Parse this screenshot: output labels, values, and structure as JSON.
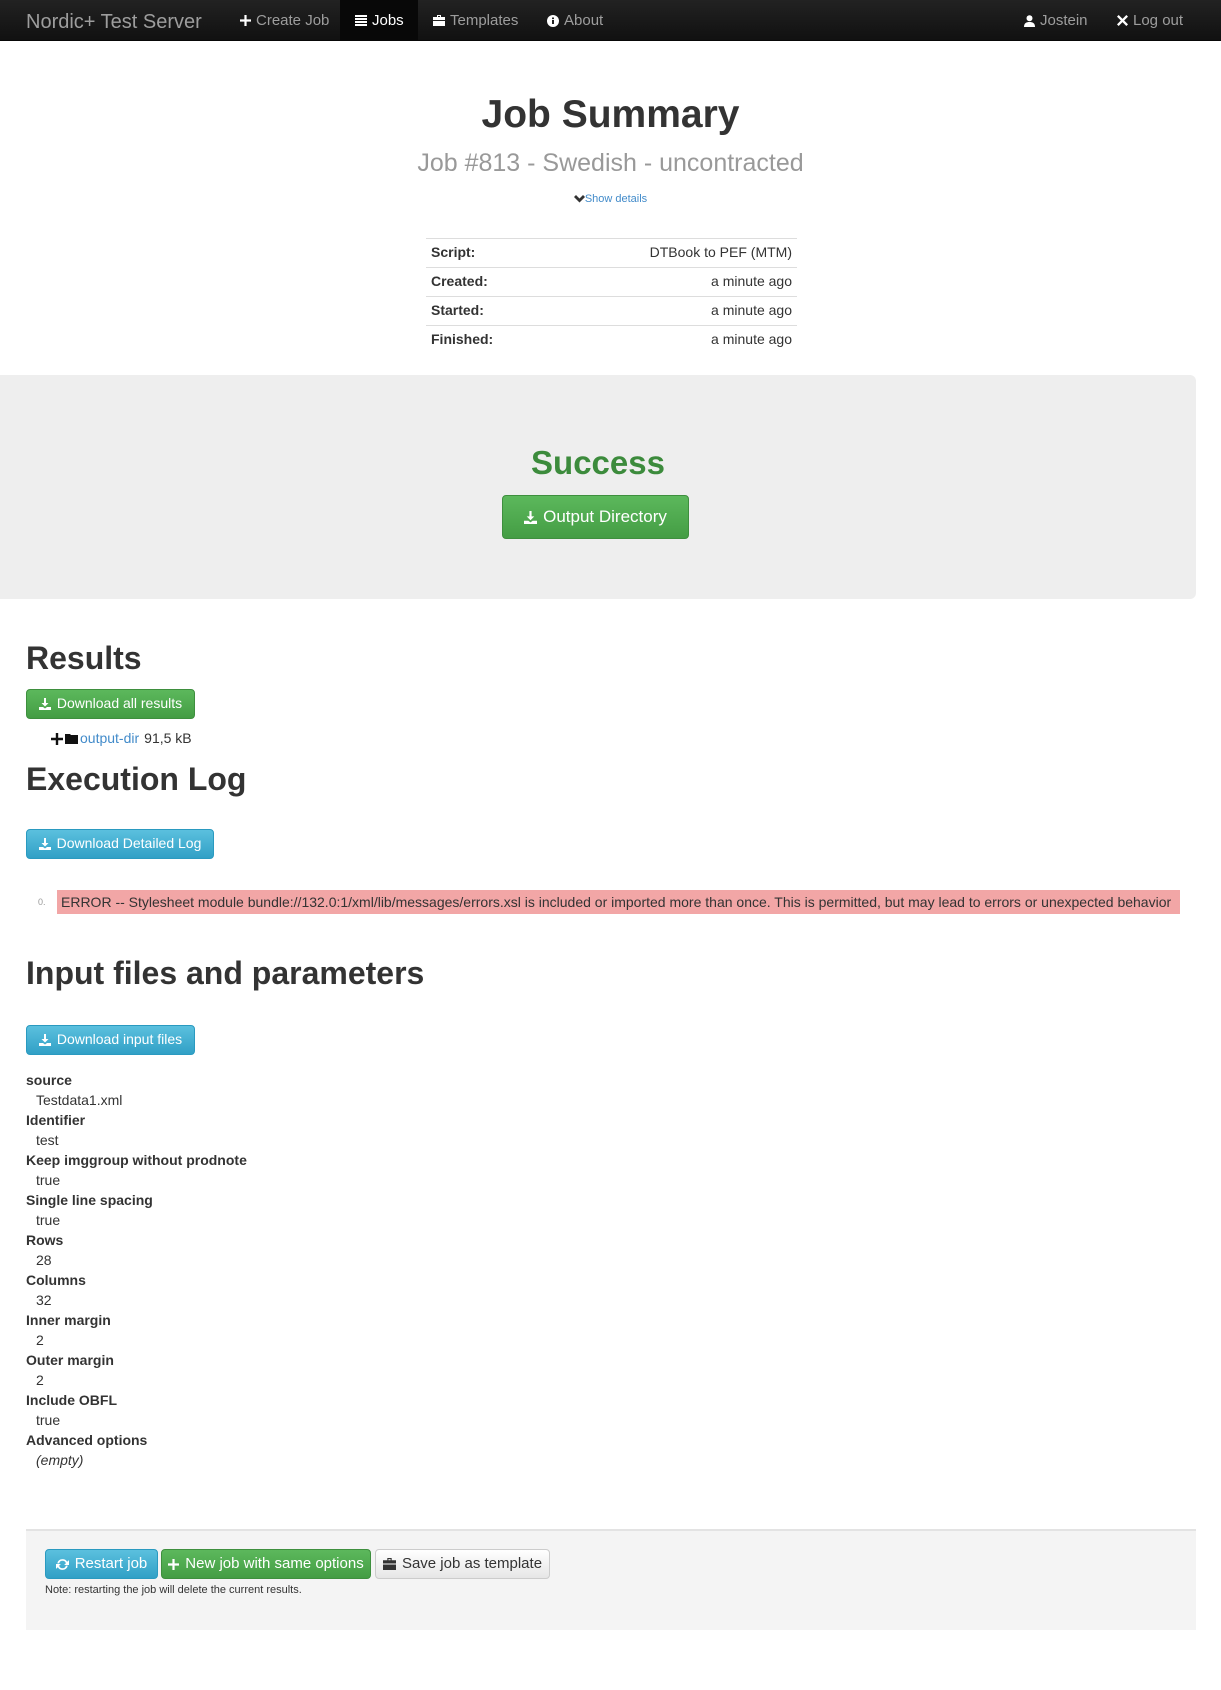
{
  "navbar": {
    "brand": "Nordic+ Test Server",
    "items": [
      {
        "label": "Create Job",
        "icon": "plus-icon",
        "active": false
      },
      {
        "label": "Jobs",
        "icon": "list-icon",
        "active": true
      },
      {
        "label": "Templates",
        "icon": "briefcase-icon",
        "active": false
      },
      {
        "label": "About",
        "icon": "info-icon",
        "active": false
      }
    ],
    "user": {
      "label": "Jostein",
      "icon": "user-icon"
    },
    "logout": {
      "label": "Log out",
      "icon": "close-icon"
    }
  },
  "header": {
    "title": "Job Summary",
    "subtitle": "Job #813 - Swedish - uncontracted",
    "show_details": "Show details"
  },
  "summary": [
    {
      "key": "Script:",
      "value": "DTBook to PEF (MTM)"
    },
    {
      "key": "Created:",
      "value": "a minute ago"
    },
    {
      "key": "Started:",
      "value": "a minute ago"
    },
    {
      "key": "Finished:",
      "value": "a minute ago"
    }
  ],
  "status": {
    "label": "Success",
    "color": "#3c8b3c",
    "output_button": "Output Directory"
  },
  "results": {
    "heading": "Results",
    "download_all": "Download all results",
    "items": [
      {
        "name": "output-dir",
        "size": "91,5 kB"
      }
    ]
  },
  "log": {
    "heading": "Execution Log",
    "download": "Download Detailed Log",
    "entries": [
      {
        "index": "0.",
        "level": "ERROR",
        "message": "ERROR -- Stylesheet module bundle://132.0:1/xml/lib/messages/errors.xsl is included or imported more than once. This is permitted, but may lead to errors or unexpected behavior",
        "color": "#f2a6a6"
      }
    ]
  },
  "inputs": {
    "heading": "Input files and parameters",
    "download": "Download input files",
    "params": [
      {
        "name": "source",
        "value": "Testdata1.xml"
      },
      {
        "name": "Identifier",
        "value": "test"
      },
      {
        "name": "Keep imggroup without prodnote",
        "value": "true"
      },
      {
        "name": "Single line spacing",
        "value": "true"
      },
      {
        "name": "Rows",
        "value": "28"
      },
      {
        "name": "Columns",
        "value": "32"
      },
      {
        "name": "Inner margin",
        "value": "2"
      },
      {
        "name": "Outer margin",
        "value": "2"
      },
      {
        "name": "Include OBFL",
        "value": "true"
      },
      {
        "name": "Advanced options",
        "value": "(empty)"
      }
    ]
  },
  "actions": {
    "restart": "Restart job",
    "new_job": "New job with same options",
    "save_template": "Save job as template",
    "note": "Note: restarting the job will delete the current results."
  }
}
